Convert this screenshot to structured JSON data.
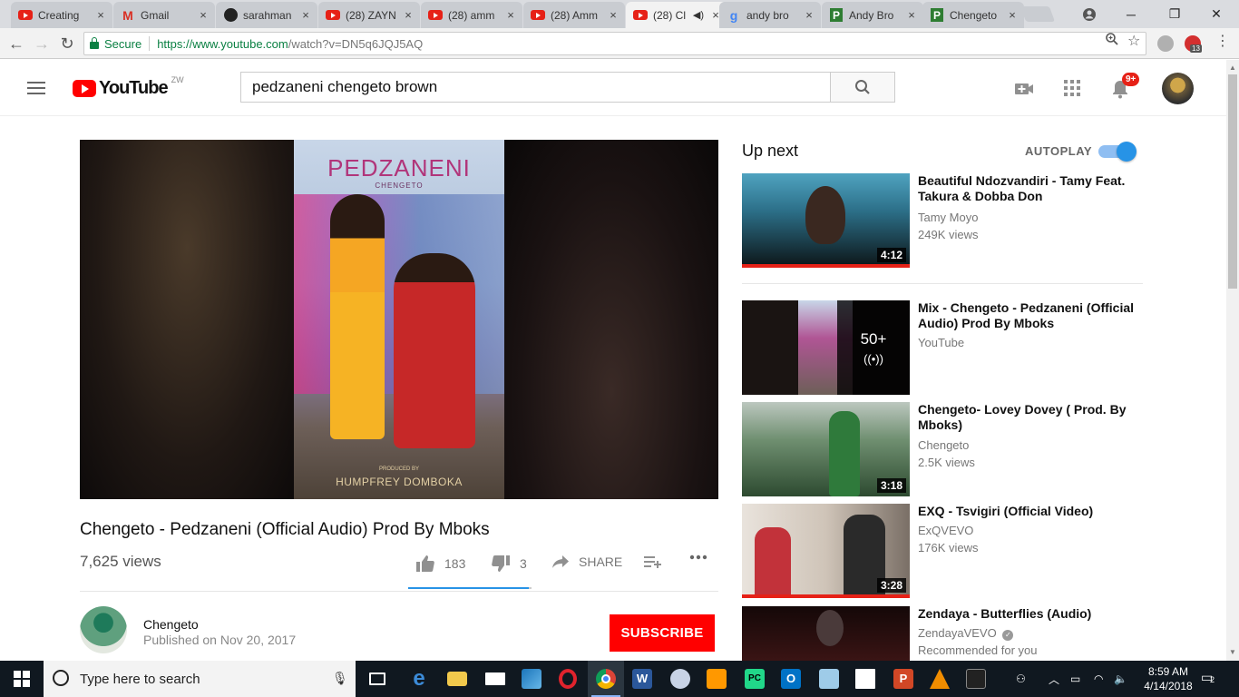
{
  "browser": {
    "tabs": [
      {
        "title": "Creating",
        "favicon": "youtube-icon"
      },
      {
        "title": "Gmail",
        "favicon": "gmail-icon"
      },
      {
        "title": "sarahman",
        "favicon": "github-icon"
      },
      {
        "title": "(28) ZAYN",
        "favicon": "youtube-icon"
      },
      {
        "title": "(28) amm",
        "favicon": "youtube-icon"
      },
      {
        "title": "(28) Amm",
        "favicon": "youtube-icon"
      },
      {
        "title": "(28) Cl",
        "favicon": "youtube-icon",
        "active": true,
        "audio": true
      },
      {
        "title": "andy bro",
        "favicon": "google-icon"
      },
      {
        "title": "Andy Bro",
        "favicon": "p-icon"
      },
      {
        "title": "Chengeto",
        "favicon": "p-icon"
      }
    ],
    "tab_close": "×",
    "secure_label": "Secure",
    "url_host": "https://www.youtube.com",
    "url_path": "/watch?v=DN5q6JQJ5AQ",
    "ext_badge": "13"
  },
  "youtube": {
    "logo_text": "YouTube",
    "country_code": "ZW",
    "search_value": "pedzaneni chengeto brown",
    "notification_count": "9+"
  },
  "video": {
    "cover_title": "PEDZANENI",
    "cover_subtitle": "CHENGETO",
    "cover_produced": "PRODUCED BY",
    "cover_producer": "HUMPFREY DOMBOKA",
    "title": "Chengeto - Pedzaneni (Official Audio) Prod By Mboks",
    "views": "7,625 views",
    "likes": "183",
    "dislikes": "3",
    "share_label": "SHARE",
    "like_ratio": 0.98,
    "channel_name": "Chengeto",
    "published": "Published on Nov 20, 2017",
    "subscribe_label": "SUBSCRIBE"
  },
  "sidebar": {
    "up_next_label": "Up next",
    "autoplay_label": "AUTOPLAY",
    "autoplay_on": true,
    "items": [
      {
        "title": "Beautiful Ndozvandiri - Tamy Feat. Takura & Dobba Don",
        "channel": "Tamy Moyo",
        "views": "249K views",
        "duration": "4:12",
        "accent": "#3e8ea8"
      },
      {
        "title": "Mix - Chengeto - Pedzaneni (Official Audio) Prod By Mboks",
        "channel": "YouTube",
        "views": "",
        "mix_count": "50+",
        "accent": "#8a5fa8"
      },
      {
        "title": "Chengeto- Lovey Dovey ( Prod. By Mboks)",
        "channel": "Chengeto",
        "views": "2.5K views",
        "duration": "3:18",
        "accent": "#2f7a3b"
      },
      {
        "title": "EXQ - Tsvigiri (Official Video)",
        "channel": "ExQVEVO",
        "views": "176K views",
        "duration": "3:28",
        "accent": "#c2323a"
      },
      {
        "title": "Zendaya - Butterflies (Audio)",
        "channel": "ZendayaVEVO",
        "views": "Recommended for you",
        "accent": "#5a1010"
      }
    ]
  },
  "taskbar": {
    "search_placeholder": "Type here to search",
    "time": "8:59 AM",
    "date": "4/14/2018",
    "notifications": "2"
  }
}
